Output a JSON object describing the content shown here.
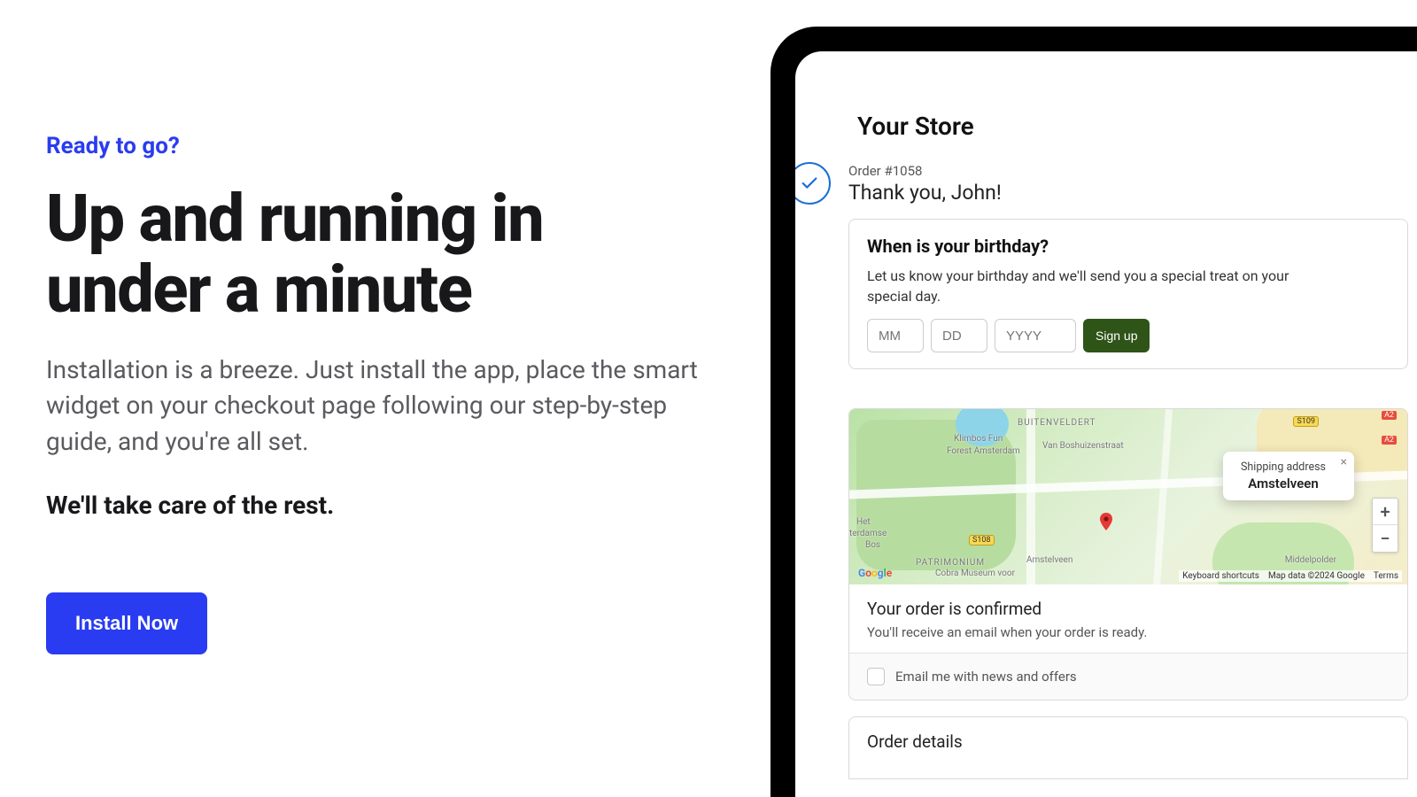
{
  "left": {
    "eyebrow": "Ready to go?",
    "headline": "Up and running in under a minute",
    "subtext": "Installation is a breeze. Just install the app, place the smart widget on your checkout page following our step-by-step guide, and you're all set.",
    "bold_line": "We'll take care of the rest.",
    "install_button": "Install Now"
  },
  "checkout": {
    "store_name": "Your Store",
    "order_number": "Order #1058",
    "thank_you": "Thank you, John!",
    "birthday": {
      "title": "When is your birthday?",
      "subtitle": "Let us know your birthday and we'll send you a special treat on your special day.",
      "placeholders": {
        "mm": "MM",
        "dd": "DD",
        "yyyy": "YYYY"
      },
      "signup_label": "Sign up"
    },
    "map": {
      "popup_label": "Shipping address",
      "popup_city": "Amstelveen",
      "labels": {
        "buitenveldert": "BUITENVELDERT",
        "klimbos": "Klimbos Fun",
        "forest": "Forest Amsterdam",
        "boshuizen": "Van Boshuizenstraat",
        "het": "Het",
        "terdamse": "terdamse",
        "bos": "Bos",
        "patrimonium": "PATRIMONIUM",
        "amstelveen": "Amstelveen",
        "cobra": "Cobra Museum voor",
        "middelpolder": "Middelpolder",
        "s108": "S108",
        "s109": "S109",
        "a2": "A2"
      },
      "zoom_in": "+",
      "zoom_out": "−",
      "footer": {
        "shortcuts": "Keyboard shortcuts",
        "mapdata": "Map data ©2024 Google",
        "terms": "Terms"
      }
    },
    "confirmed": {
      "title": "Your order is confirmed",
      "subtitle": "You'll receive an email when your order is ready."
    },
    "email_optin": "Email me with news and offers",
    "order_details_title": "Order details"
  }
}
